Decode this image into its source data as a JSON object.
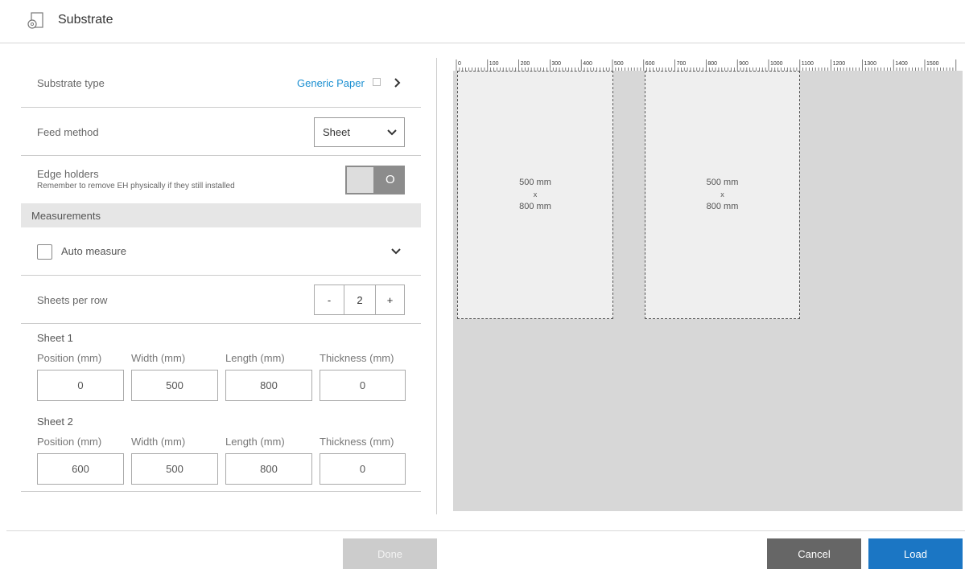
{
  "header": {
    "title": "Substrate"
  },
  "form": {
    "substrate_type": {
      "label": "Substrate type",
      "value": "Generic Paper"
    },
    "feed_method": {
      "label": "Feed method",
      "value": "Sheet"
    },
    "edge_holders": {
      "label": "Edge holders",
      "hint": "Remember to remove EH physically if they still installed",
      "toggle_text": "O",
      "enabled": false
    },
    "measurements": {
      "section_label": "Measurements",
      "auto_measure_label": "Auto measure",
      "auto_measure_checked": false
    },
    "sheets_per_row": {
      "label": "Sheets per row",
      "minus": "-",
      "value": "2",
      "plus": "+"
    },
    "columns": [
      "Position (mm)",
      "Width (mm)",
      "Length (mm)",
      "Thickness (mm)"
    ],
    "sheets": [
      {
        "title": "Sheet 1",
        "values": [
          "0",
          "500",
          "800",
          "0"
        ]
      },
      {
        "title": "Sheet 2",
        "values": [
          "600",
          "500",
          "800",
          "0"
        ]
      }
    ]
  },
  "preview": {
    "ruler_labels": [
      "0",
      "100",
      "200",
      "300",
      "400",
      "500",
      "600",
      "700",
      "800",
      "900",
      "1000",
      "1100",
      "1200",
      "1300",
      "1400",
      "1500"
    ],
    "sheets": [
      {
        "width": "500 mm",
        "x": "x",
        "length": "800 mm"
      },
      {
        "width": "500 mm",
        "x": "x",
        "length": "800 mm"
      }
    ]
  },
  "footer": {
    "done": "Done",
    "cancel": "Cancel",
    "load": "Load"
  },
  "colors": {
    "accent": "#1b8fd1",
    "cancel_bg": "#666666",
    "done_bg": "#cccccc",
    "load_bg": "#1b76c4"
  }
}
